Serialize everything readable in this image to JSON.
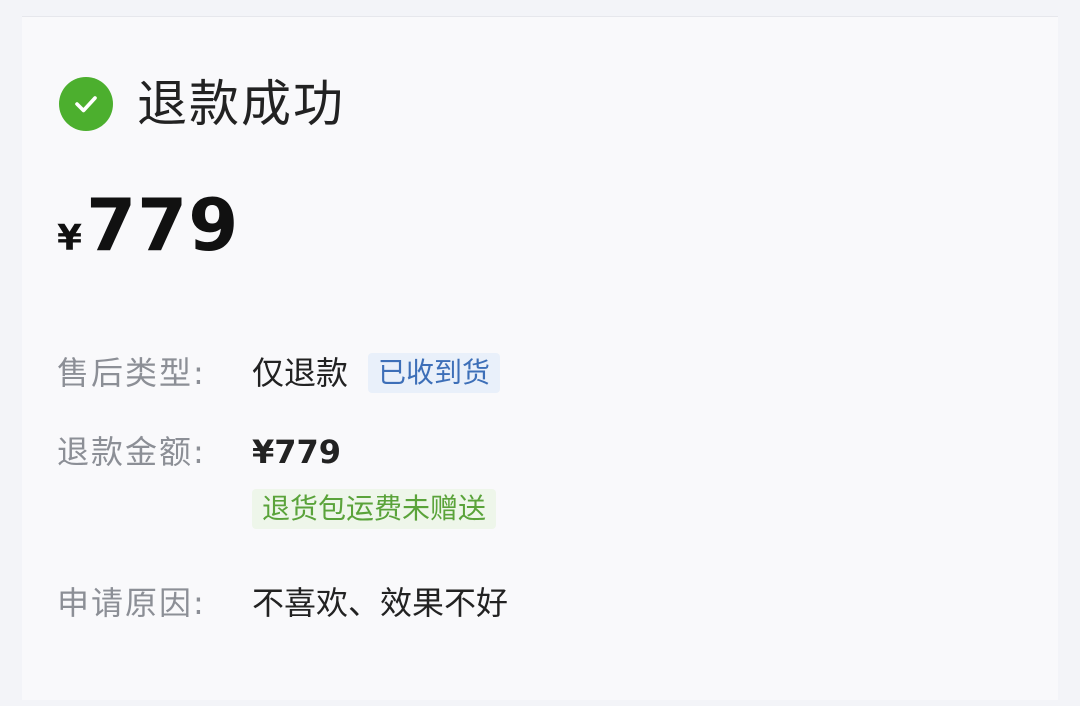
{
  "status": {
    "icon": "check-circle-icon",
    "title": "退款成功",
    "color": "#4caf2e"
  },
  "amount": {
    "currency": "¥",
    "value": "779"
  },
  "details": {
    "type_label": "售后类型:",
    "type_value": "仅退款",
    "type_tag": "已收到货",
    "refund_label": "退款金额:",
    "refund_value": "¥779",
    "shipping_tag": "退货包运费未赠送",
    "reason_label": "申请原因:",
    "reason_value": "不喜欢、效果不好"
  }
}
